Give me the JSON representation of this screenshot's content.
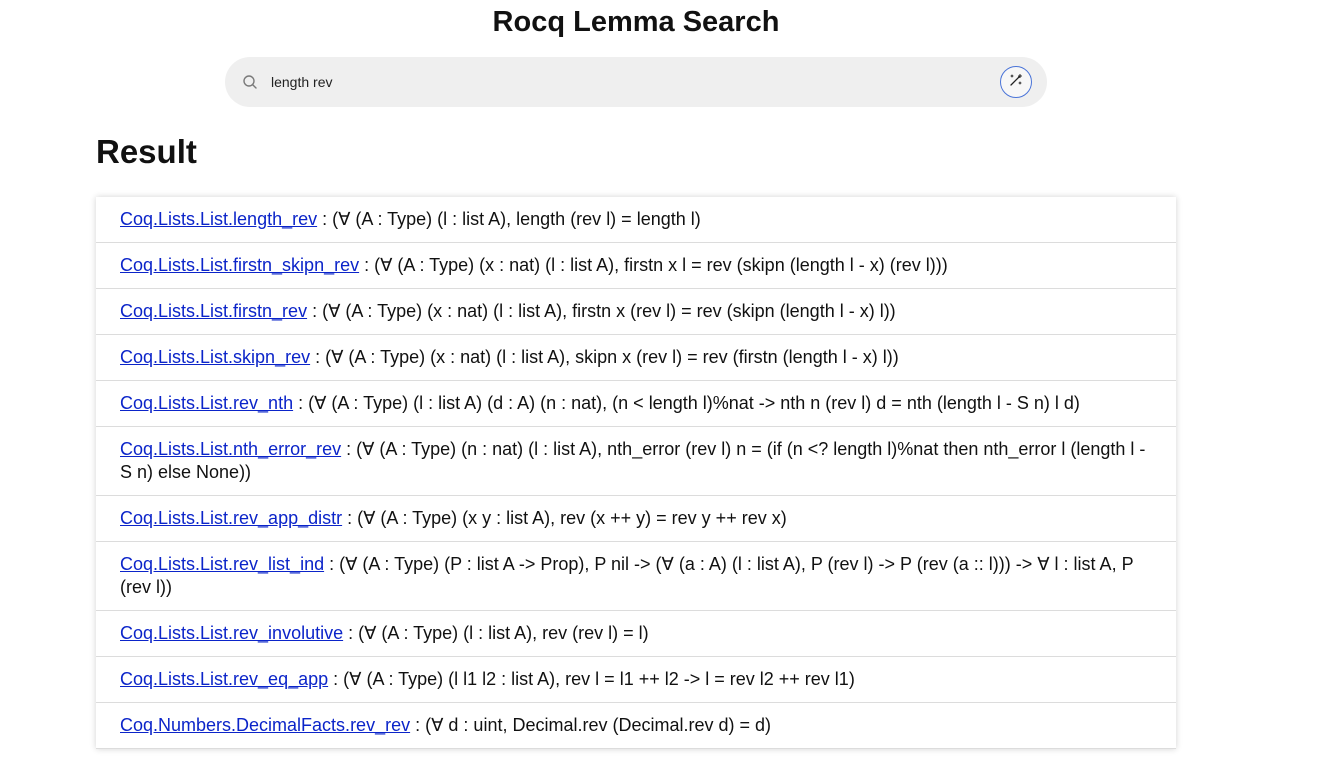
{
  "header": {
    "title": "Rocq Lemma Search"
  },
  "search": {
    "value": "length rev",
    "icons": {
      "search": "search-icon",
      "action": "magic-wand-icon"
    }
  },
  "results": {
    "heading": "Result",
    "items": [
      {
        "name": "Coq.Lists.List.length_rev",
        "type": ": (∀ (A : Type) (l : list A), length (rev l) = length l)"
      },
      {
        "name": "Coq.Lists.List.firstn_skipn_rev",
        "type": ": (∀ (A : Type) (x : nat) (l : list A), firstn x l = rev (skipn (length l - x) (rev l)))"
      },
      {
        "name": "Coq.Lists.List.firstn_rev",
        "type": ": (∀ (A : Type) (x : nat) (l : list A), firstn x (rev l) = rev (skipn (length l - x) l))"
      },
      {
        "name": "Coq.Lists.List.skipn_rev",
        "type": ": (∀ (A : Type) (x : nat) (l : list A), skipn x (rev l) = rev (firstn (length l - x) l))"
      },
      {
        "name": "Coq.Lists.List.rev_nth",
        "type": ": (∀ (A : Type) (l : list A) (d : A) (n : nat), (n < length l)%nat -> nth n (rev l) d = nth (length l - S n) l d)"
      },
      {
        "name": "Coq.Lists.List.nth_error_rev",
        "type": ": (∀ (A : Type) (n : nat) (l : list A), nth_error (rev l) n = (if (n <? length l)%nat then nth_error l (length l - S n) else None))"
      },
      {
        "name": "Coq.Lists.List.rev_app_distr",
        "type": ": (∀ (A : Type) (x y : list A), rev (x ++ y) = rev y ++ rev x)"
      },
      {
        "name": "Coq.Lists.List.rev_list_ind",
        "type": ": (∀ (A : Type) (P : list A -> Prop), P nil -> (∀ (a : A) (l : list A), P (rev l) -> P (rev (a :: l))) -> ∀ l : list A, P (rev l))"
      },
      {
        "name": "Coq.Lists.List.rev_involutive",
        "type": ": (∀ (A : Type) (l : list A), rev (rev l) = l)"
      },
      {
        "name": "Coq.Lists.List.rev_eq_app",
        "type": ": (∀ (A : Type) (l l1 l2 : list A), rev l = l1 ++ l2 -> l = rev l2 ++ rev l1)"
      },
      {
        "name": "Coq.Numbers.DecimalFacts.rev_rev",
        "type": ": (∀ d : uint, Decimal.rev (Decimal.rev d) = d)"
      }
    ]
  },
  "colors": {
    "link": "#0b24c9",
    "search_bg": "#efefef",
    "accent": "#4a74d8"
  }
}
